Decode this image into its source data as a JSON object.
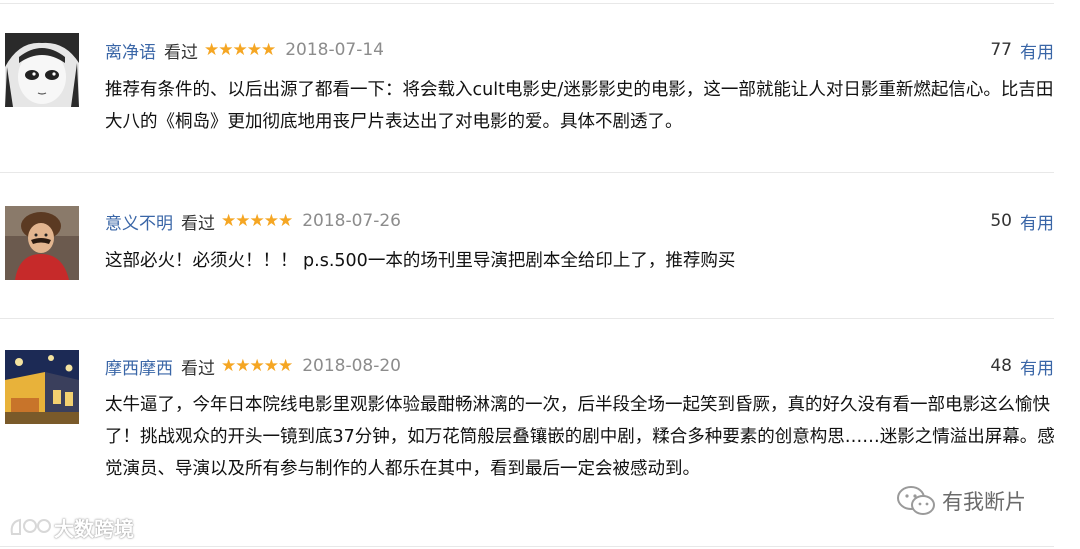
{
  "reviews": [
    {
      "user": "离净语",
      "status": "看过",
      "stars": "★★★★★",
      "rating": 5,
      "date": "2018-07-14",
      "count": "77",
      "useful": "有用",
      "text": "推荐有条件的、以后出源了都看一下：将会载入cult电影史/迷影影史的电影，这一部就能让人对日影重新燃起信心。比吉田大八的《桐岛》更加彻底地用丧尸片表达出了对电影的爱。具体不剧透了。"
    },
    {
      "user": "意义不明",
      "status": "看过",
      "stars": "★★★★★",
      "rating": 5,
      "date": "2018-07-26",
      "count": "50",
      "useful": "有用",
      "text": "这部必火！必须火！！！ p.s.500一本的场刊里导演把剧本全给印上了，推荐购买"
    },
    {
      "user": "摩西摩西",
      "status": "看过",
      "stars": "★★★★★",
      "rating": 5,
      "date": "2018-08-20",
      "count": "48",
      "useful": "有用",
      "text": "太牛逼了，今年日本院线电影里观影体验最酣畅淋漓的一次，后半段全场一起笑到昏厥，真的好久没有看一部电影这么愉快了！挑战观众的开头一镜到底37分钟，如万花筒般层叠镶嵌的剧中剧，糅合多种要素的创意构思……迷影之情溢出屏幕。感觉演员、导演以及所有参与制作的人都乐在其中，看到最后一定会被感动到。"
    }
  ],
  "watermarks": {
    "left": "大数跨境",
    "right": "有我断片"
  },
  "colors": {
    "username": "#3a66a7",
    "star": "#f5a623",
    "date": "#8c8c8c",
    "divider": "#e8e8e8"
  }
}
